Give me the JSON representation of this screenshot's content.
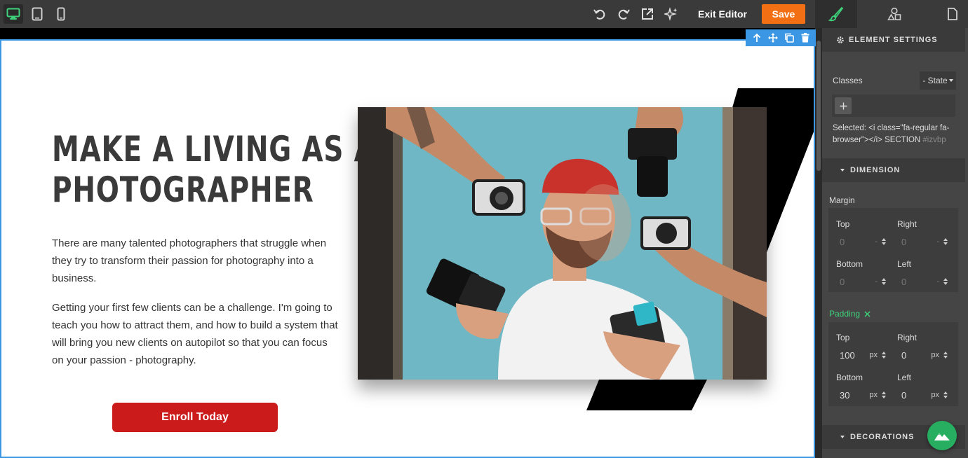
{
  "toolbar": {
    "exit_label": "Exit Editor",
    "save_label": "Save",
    "accent_color": "#f27013",
    "device_icons": [
      "desktop-icon",
      "tablet-icon",
      "mobile-icon"
    ],
    "action_icons": [
      "undo-icon",
      "redo-icon",
      "open-external-icon",
      "sparkle-icon"
    ],
    "panel_tab_icons": [
      "brush-icon",
      "shapes-icon",
      "page-icon"
    ]
  },
  "canvas": {
    "title_line1": "MAKE A LIVING AS A",
    "title_line2": "PHOTOGRAPHER",
    "paragraph1": "There are many talented photographers that struggle when they try to transform their passion for photography into a business.",
    "paragraph2": "Getting your first few clients can be a challenge. I'm going to teach you how to attract them, and how to build a system that will bring you new clients on autopilot so that you can focus on your passion - photography.",
    "cta_label": "Enroll Today",
    "cta_color": "#cc1b1b",
    "selection_color": "#3b97e3",
    "element_toolbar_icons": [
      "arrow-up-icon",
      "move-icon",
      "copy-icon",
      "trash-icon"
    ]
  },
  "panel": {
    "element_settings": "ELEMENT SETTINGS",
    "classes_label": "Classes",
    "state_label": "- State",
    "selected_prefix": "Selected:",
    "selected_line1": "<i class=\"fa-regular fa-",
    "selected_line2": "browser\"></i> SECTION",
    "selected_id": "#izvbp",
    "dimension": "DIMENSION",
    "margin_label": "Margin",
    "padding_label": "Padding",
    "padding_color": "#3ed07a",
    "decorations": "DECORATIONS",
    "margin": {
      "top": {
        "label": "Top",
        "value": "0",
        "unit": "-"
      },
      "right": {
        "label": "Right",
        "value": "0",
        "unit": "-"
      },
      "bottom": {
        "label": "Bottom",
        "value": "0",
        "unit": "-"
      },
      "left": {
        "label": "Left",
        "value": "0",
        "unit": "-"
      }
    },
    "padding": {
      "top": {
        "label": "Top",
        "value": "100",
        "unit": "px"
      },
      "right": {
        "label": "Right",
        "value": "0",
        "unit": "px"
      },
      "bottom": {
        "label": "Bottom",
        "value": "30",
        "unit": "px"
      },
      "left": {
        "label": "Left",
        "value": "0",
        "unit": "px"
      }
    }
  }
}
